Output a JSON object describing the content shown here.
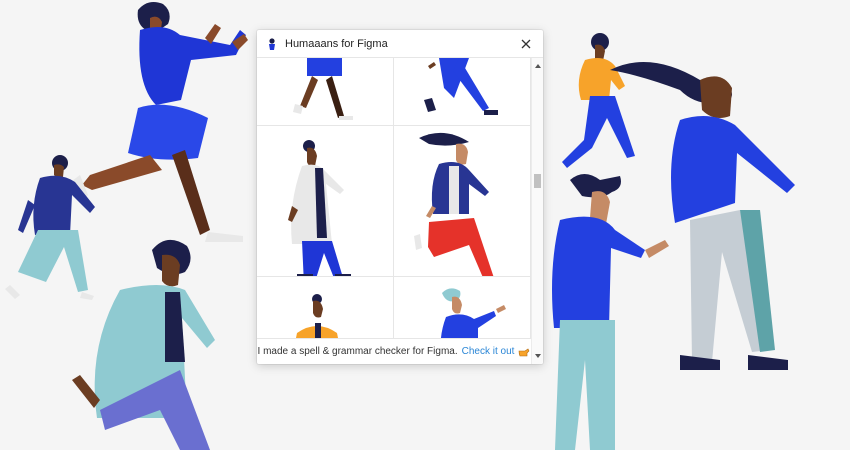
{
  "plugin": {
    "title": "Humaaans for Figma",
    "close_icon": "close-icon",
    "logo_icon": "figure-logo-icon",
    "footer": {
      "text": "I made a spell & grammar checker for Figma.",
      "link_label": "Check it out",
      "pointer_icon": "pointing-hand-icon"
    }
  },
  "colors": {
    "accent_blue": "#1f36d6",
    "royal_blue": "#2340e0",
    "teal": "#8fcad1",
    "navy": "#1c1f4a",
    "orange": "#f7a32a",
    "red": "#e5322a",
    "link": "#2a86d6"
  }
}
